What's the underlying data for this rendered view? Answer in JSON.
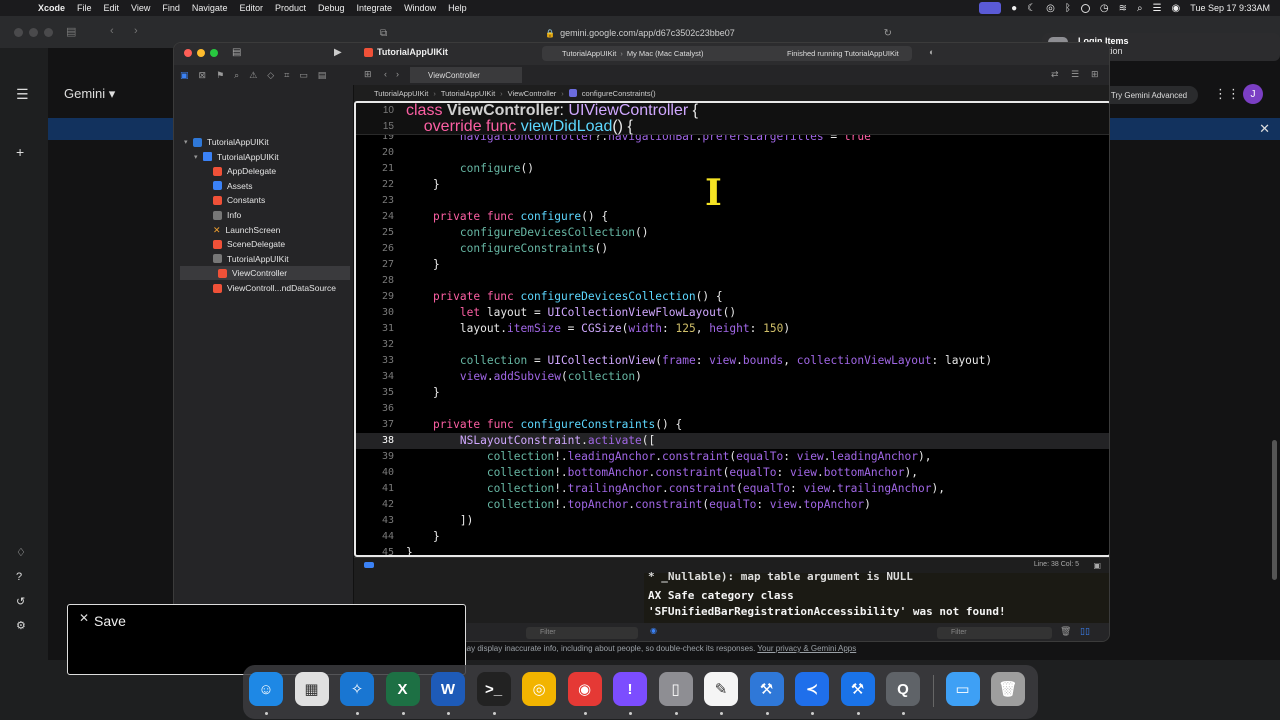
{
  "menubar": {
    "apple": "",
    "app": "Xcode",
    "items": [
      "File",
      "Edit",
      "View",
      "Find",
      "Navigate",
      "Editor",
      "Product",
      "Debug",
      "Integrate",
      "Window",
      "Help"
    ],
    "clock": "Tue Sep 17  9:33AM"
  },
  "browser": {
    "url": "gemini.google.com/app/d67c3502c23bbe07"
  },
  "gemini": {
    "title": "Gemini ▾",
    "try_advanced": "Try Gemini Advanced",
    "avatar_letter": "J",
    "disclaimer_prefix": "may display inaccurate info, including about people, so double-check its responses.",
    "disclaimer_link": "Your privacy & Gemini Apps"
  },
  "notification": {
    "title": "Login Items",
    "subtitle": "Notification"
  },
  "xcode": {
    "project": "TutorialAppUIKit",
    "scheme": "TutorialAppUIKit",
    "destination": "My Mac (Mac Catalyst)",
    "status": "Finished running TutorialAppUIKit",
    "tab": "ViewController",
    "jumpbar": [
      "TutorialAppUIKit",
      "TutorialAppUIKit",
      "ViewController",
      "configureConstraints()"
    ],
    "line_col": "Line: 38  Col: 5",
    "filter_placeholder": "Filter",
    "navigator": [
      {
        "label": "TutorialAppUIKit",
        "kind": "proj",
        "indent": 0,
        "disc": "▾"
      },
      {
        "label": "TutorialAppUIKit",
        "kind": "folder",
        "indent": 1,
        "disc": "▾"
      },
      {
        "label": "AppDelegate",
        "kind": "swift",
        "indent": 2
      },
      {
        "label": "Assets",
        "kind": "assets",
        "indent": 2
      },
      {
        "label": "Constants",
        "kind": "swift",
        "indent": 2
      },
      {
        "label": "Info",
        "kind": "info",
        "indent": 2
      },
      {
        "label": "LaunchScreen",
        "kind": "sb",
        "indent": 2
      },
      {
        "label": "SceneDelegate",
        "kind": "swift",
        "indent": 2
      },
      {
        "label": "TutorialAppUIKit",
        "kind": "info",
        "indent": 2
      },
      {
        "label": "ViewController",
        "kind": "swift",
        "indent": 2,
        "selected": true
      },
      {
        "label": "ViewControll...ndDataSource",
        "kind": "swift",
        "indent": 2
      }
    ],
    "console": {
      "line0": "* _Nullable): map table argument is NULL",
      "line1": "AX Safe category class",
      "line2": "'SFUnifiedBarRegistrationAccessibility' was not found!"
    }
  },
  "code": {
    "sticky": [
      {
        "num": "10",
        "html": "<span class=\"kw\">class</span> <span class=\"cls\">ViewController</span>: <span class=\"tyb\">UIViewController</span> {"
      },
      {
        "num": "15",
        "html": "    <span class=\"kw\">override func</span> <span class=\"ty\">viewDidLoad</span>() {"
      }
    ],
    "lines": [
      {
        "num": "19",
        "html": "        <span class=\"mem\">navigationController</span>?.<span class=\"mem\">navigationBar</span>.<span class=\"mem\">prefersLargeTitles</span> = <span class=\"kw\">true</span>"
      },
      {
        "num": "20",
        "html": ""
      },
      {
        "num": "21",
        "html": "        <span class=\"fn\">configure</span>()"
      },
      {
        "num": "22",
        "html": "    }"
      },
      {
        "num": "23",
        "html": ""
      },
      {
        "num": "24",
        "html": "    <span class=\"kw\">private func</span> <span class=\"ty\">configure</span>() {"
      },
      {
        "num": "25",
        "html": "        <span class=\"fn\">configureDevicesCollection</span>()"
      },
      {
        "num": "26",
        "html": "        <span class=\"fn\">configureConstraints</span>()"
      },
      {
        "num": "27",
        "html": "    }"
      },
      {
        "num": "28",
        "html": ""
      },
      {
        "num": "29",
        "html": "    <span class=\"kw\">private func</span> <span class=\"ty\">configureDevicesCollection</span>() {"
      },
      {
        "num": "30",
        "html": "        <span class=\"kw\">let</span> layout = <span class=\"tyb\">UICollectionViewFlowLayout</span>()"
      },
      {
        "num": "31",
        "html": "        layout.<span class=\"mem\">itemSize</span> = <span class=\"tyb\">CGSize</span>(<span class=\"mem\">width</span>: <span class=\"num\">125</span>, <span class=\"mem\">height</span>: <span class=\"num\">150</span>)"
      },
      {
        "num": "32",
        "html": ""
      },
      {
        "num": "33",
        "html": "        <span class=\"fn\">collection</span> = <span class=\"tyb\">UICollectionView</span>(<span class=\"mem\">frame</span>: <span class=\"mem\">view</span>.<span class=\"mem\">bounds</span>, <span class=\"mem\">collectionViewLayout</span>: layout)"
      },
      {
        "num": "34",
        "html": "        <span class=\"mem\">view</span>.<span class=\"mem\">addSubview</span>(<span class=\"fn\">collection</span>)"
      },
      {
        "num": "35",
        "html": "    }"
      },
      {
        "num": "36",
        "html": ""
      },
      {
        "num": "37",
        "html": "    <span class=\"kw\">private func</span> <span class=\"ty\">configureConstraints</span>() {"
      },
      {
        "num": "38",
        "html": "        <span class=\"tyb\">NSLayoutConstraint</span>.<span class=\"mem\">activate</span>([",
        "current": true
      },
      {
        "num": "39",
        "html": "            <span class=\"fn\">collection</span>!.<span class=\"mem\">leadingAnchor</span>.<span class=\"mem\">constraint</span>(<span class=\"mem\">equalTo</span>: <span class=\"mem\">view</span>.<span class=\"mem\">leadingAnchor</span>),"
      },
      {
        "num": "40",
        "html": "            <span class=\"fn\">collection</span>!.<span class=\"mem\">bottomAnchor</span>.<span class=\"mem\">constraint</span>(<span class=\"mem\">equalTo</span>: <span class=\"mem\">view</span>.<span class=\"mem\">bottomAnchor</span>),"
      },
      {
        "num": "41",
        "html": "            <span class=\"fn\">collection</span>!.<span class=\"mem\">trailingAnchor</span>.<span class=\"mem\">constraint</span>(<span class=\"mem\">equalTo</span>: <span class=\"mem\">view</span>.<span class=\"mem\">trailingAnchor</span>),"
      },
      {
        "num": "42",
        "html": "            <span class=\"fn\">collection</span>!.<span class=\"mem\">topAnchor</span>.<span class=\"mem\">constraint</span>(<span class=\"mem\">equalTo</span>: <span class=\"mem\">view</span>.<span class=\"mem\">topAnchor</span>)"
      },
      {
        "num": "43",
        "html": "        ])"
      },
      {
        "num": "44",
        "html": "    }"
      },
      {
        "num": "45",
        "html": "}"
      }
    ]
  },
  "save_dialog": {
    "close": "✕",
    "label": "Save"
  },
  "dock": {
    "items": [
      {
        "name": "finder",
        "glyph": "☺",
        "color": "#1e88e5",
        "running": true
      },
      {
        "name": "launchpad",
        "glyph": "▦",
        "color": "#e0e0e0",
        "running": false
      },
      {
        "name": "safari",
        "glyph": "✧",
        "color": "#1976d2",
        "running": true
      },
      {
        "name": "excel",
        "glyph": "X",
        "color": "#1d7044",
        "running": true
      },
      {
        "name": "word",
        "glyph": "W",
        "color": "#1e5bb8",
        "running": true
      },
      {
        "name": "terminal",
        "glyph": ">_",
        "color": "#222222",
        "running": true
      },
      {
        "name": "chrome-canary",
        "glyph": "◎",
        "color": "#f2b400",
        "running": false
      },
      {
        "name": "chrome",
        "glyph": "◉",
        "color": "#e53935",
        "running": true
      },
      {
        "name": "feedback",
        "glyph": "!",
        "color": "#7c4dff",
        "running": true
      },
      {
        "name": "simulator",
        "glyph": "▯",
        "color": "#8e8e93",
        "running": true
      },
      {
        "name": "textedit",
        "glyph": "✎",
        "color": "#f5f5f5",
        "running": true
      },
      {
        "name": "xcode-beta",
        "glyph": "⚒",
        "color": "#2f78d8",
        "running": true
      },
      {
        "name": "vscode",
        "glyph": "≺",
        "color": "#1f6feb",
        "running": true
      },
      {
        "name": "xcode",
        "glyph": "⚒",
        "color": "#1a73e8",
        "running": true
      },
      {
        "name": "quicktime",
        "glyph": "Q",
        "color": "#5f6368",
        "running": true
      },
      {
        "name": "downloads",
        "glyph": "▭",
        "color": "#3ea0f5",
        "running": false
      },
      {
        "name": "trash",
        "glyph": "🗑",
        "color": "#9e9e9e",
        "running": false
      }
    ]
  }
}
